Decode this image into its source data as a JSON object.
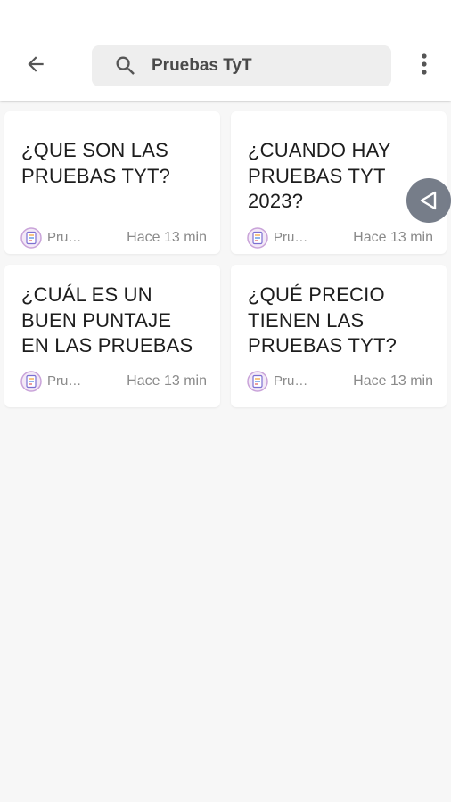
{
  "header": {
    "search_value": "Pruebas TyT"
  },
  "cards": [
    {
      "title": "¿QUE SON LAS\nPRUEBAS TYT?",
      "source": "Pruebas TyT",
      "time": "Hace 13 min"
    },
    {
      "title": "¿CUANDO HAY\nPRUEBAS TYT\n2023?",
      "source": "Pruebas TyT",
      "time": "Hace 13 min"
    },
    {
      "title": "¿CUÁL ES UN\nBUEN PUNTAJE\nEN LAS PRUEBAS",
      "source": "Pruebas TyT",
      "time": "Hace 13 min"
    },
    {
      "title": "¿QUÉ PRECIO\nTIENEN LAS\nPRUEBAS TYT?",
      "source": "Pruebas TyT",
      "time": "Hace 13 min"
    }
  ],
  "icons": {
    "back": "arrow-left-icon",
    "search": "search-icon",
    "more": "more-vertical-icon",
    "float": "triangle-left-icon",
    "source": "source-logo-icon"
  },
  "colors": {
    "background": "#f7f7f7",
    "card": "#ffffff",
    "search_box": "#eeeeee",
    "title_text": "#1d1d1d",
    "meta_text": "#8a8a8a",
    "float_button": "#6b7280"
  }
}
